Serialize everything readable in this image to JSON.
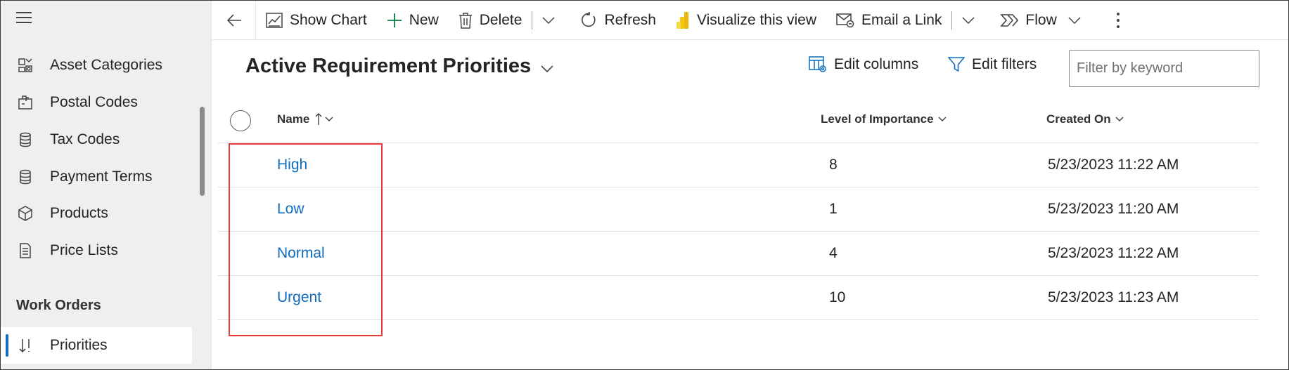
{
  "sidebar": {
    "items": [
      {
        "label": "Asset Categories",
        "icon": "asset-categories-icon"
      },
      {
        "label": "Postal Codes",
        "icon": "postal-codes-icon"
      },
      {
        "label": "Tax Codes",
        "icon": "tax-codes-icon"
      },
      {
        "label": "Payment Terms",
        "icon": "payment-terms-icon"
      },
      {
        "label": "Products",
        "icon": "products-icon"
      },
      {
        "label": "Price Lists",
        "icon": "price-lists-icon"
      }
    ],
    "group_title": "Work Orders",
    "selected_item": {
      "label": "Priorities",
      "icon": "priorities-icon"
    }
  },
  "toolbar": {
    "show_chart": "Show Chart",
    "new": "New",
    "delete": "Delete",
    "refresh": "Refresh",
    "visualize": "Visualize this view",
    "email_link": "Email a Link",
    "flow": "Flow"
  },
  "view": {
    "title": "Active Requirement Priorities",
    "edit_columns": "Edit columns",
    "edit_filters": "Edit filters",
    "filter_placeholder": "Filter by keyword"
  },
  "grid": {
    "columns": {
      "name": "Name",
      "level": "Level of Importance",
      "created": "Created On"
    },
    "rows": [
      {
        "name": "High",
        "level": "8",
        "created": "5/23/2023 11:22 AM"
      },
      {
        "name": "Low",
        "level": "1",
        "created": "5/23/2023 11:20 AM"
      },
      {
        "name": "Normal",
        "level": "4",
        "created": "5/23/2023 11:22 AM"
      },
      {
        "name": "Urgent",
        "level": "10",
        "created": "5/23/2023 11:23 AM"
      }
    ]
  },
  "colors": {
    "accent": "#0f6cbd",
    "highlight_border": "#e8393c",
    "sidebar_bg": "#efefef"
  }
}
